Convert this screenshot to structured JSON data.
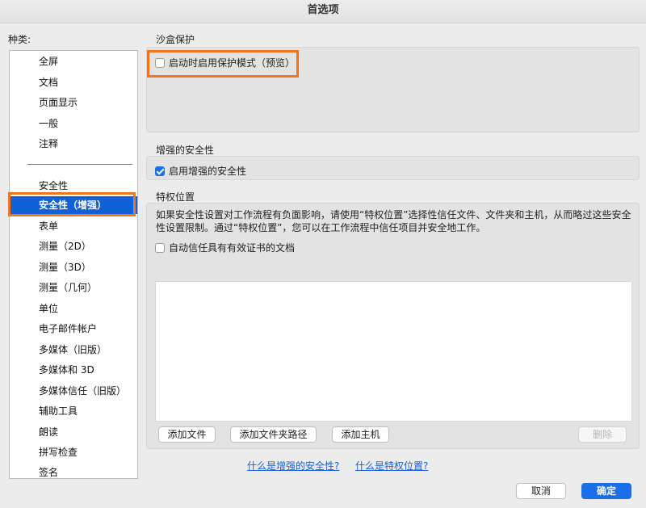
{
  "window": {
    "title": "首选项"
  },
  "categories_label": "种类:",
  "sidebar": {
    "items": [
      {
        "label": "全屏"
      },
      {
        "label": "文档"
      },
      {
        "label": "页面显示"
      },
      {
        "label": "一般"
      },
      {
        "label": "注释"
      },
      {
        "label": "安全性"
      },
      {
        "label": "安全性（增强）",
        "selected": true
      },
      {
        "label": "表单"
      },
      {
        "label": "测量（2D）"
      },
      {
        "label": "测量（3D）"
      },
      {
        "label": "测量（几何）"
      },
      {
        "label": "单位"
      },
      {
        "label": "电子邮件帐户"
      },
      {
        "label": "多媒体（旧版）"
      },
      {
        "label": "多媒体和 3D"
      },
      {
        "label": "多媒体信任（旧版）"
      },
      {
        "label": "辅助工具"
      },
      {
        "label": "朗读"
      },
      {
        "label": "拼写检查"
      },
      {
        "label": "签名"
      }
    ]
  },
  "sandbox": {
    "title": "沙盒保护",
    "protected_mode_label": "启动时启用保护模式（预览）",
    "protected_mode_checked": false
  },
  "enhanced": {
    "title": "增强的安全性",
    "enable_label": "启用增强的安全性",
    "enable_checked": true
  },
  "privileged": {
    "title": "特权位置",
    "description": "如果安全性设置对工作流程有负面影响，请使用“特权位置”选择性信任文件、文件夹和主机，从而略过这些安全性设置限制。通过“特权位置”，您可以在工作流程中信任项目并安全地工作。",
    "auto_trust_label": "自动信任具有有效证书的文档",
    "auto_trust_checked": false,
    "add_file": "添加文件",
    "add_folder": "添加文件夹路径",
    "add_host": "添加主机",
    "remove": "删除"
  },
  "links": {
    "what_enhanced": "什么是增强的安全性?",
    "what_privileged": "什么是特权位置?"
  },
  "footer": {
    "cancel": "取消",
    "ok": "确定"
  },
  "colors": {
    "selection": "#1160d8",
    "highlight_outline": "#f0761e",
    "primary_button": "#1b6fe6",
    "link": "#1b5fd6"
  }
}
